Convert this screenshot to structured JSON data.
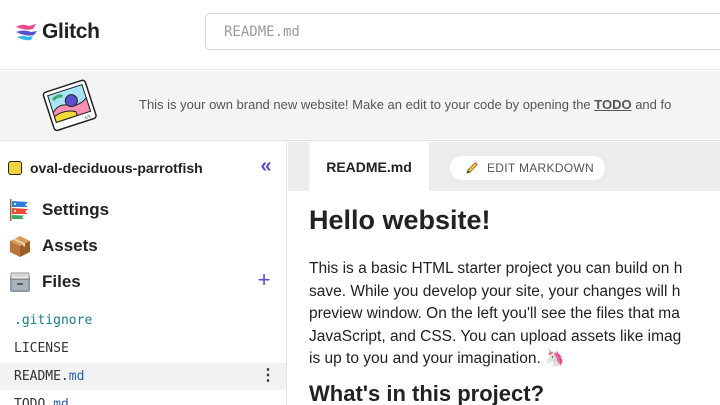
{
  "header": {
    "logo_text": "Glitch",
    "search_placeholder": "README.md"
  },
  "banner": {
    "text_before": "This is your own brand new website! Make an edit to your code by opening the ",
    "link": "TODO",
    "text_after": " and fo"
  },
  "sidebar": {
    "project_name": "oval-deciduous-parrotfish",
    "collapse_glyph": "«",
    "nav": [
      {
        "label": "Settings",
        "icon": "carp-streamer-icon"
      },
      {
        "label": "Assets",
        "icon": "package-icon"
      },
      {
        "label": "Files",
        "icon": "file-cabinet-icon"
      }
    ],
    "add_glyph": "+",
    "files": [
      {
        "name": ".gitignore",
        "ext": ""
      },
      {
        "name": "LICENSE",
        "ext": ""
      },
      {
        "name": "README.",
        "ext": "md"
      },
      {
        "name": "TODO.",
        "ext": "md"
      }
    ],
    "file_menu_glyph": "⋮"
  },
  "editor": {
    "active_tab": "README.md",
    "edit_button": "EDIT MARKDOWN",
    "heading": "Hello website!",
    "paragraph_lines": [
      "This is a basic HTML starter project you can build on h",
      "save. While you develop your site, your changes will h",
      "preview window. On the left you'll see the files that ma",
      "JavaScript, and CSS. You can upload assets like imag",
      "is up to you and your imagination. 🦄"
    ],
    "subheading": "What's in this project?"
  },
  "colors": {
    "accent": "#5a4fcf",
    "file_ext": "#2a5db0",
    "tab_bar": "#ececec",
    "banner_bg": "#f4f4f4"
  }
}
